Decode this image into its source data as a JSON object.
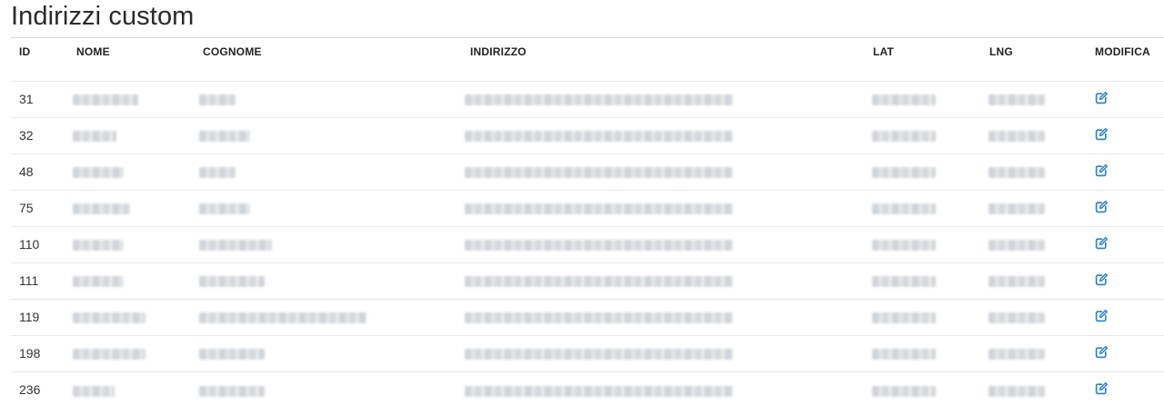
{
  "page": {
    "title": "Indirizzi custom"
  },
  "table": {
    "columns": [
      "ID",
      "NOME",
      "COGNOME",
      "INDIRIZZO",
      "LAT",
      "LNG",
      "MODIFICA"
    ],
    "rows": [
      {
        "id": "31"
      },
      {
        "id": "32"
      },
      {
        "id": "48"
      },
      {
        "id": "75"
      },
      {
        "id": "110"
      },
      {
        "id": "111"
      },
      {
        "id": "119"
      },
      {
        "id": "198"
      },
      {
        "id": "236"
      }
    ],
    "edit_icon": "edit-square-pen-icon",
    "redacted_cells": [
      "NOME",
      "COGNOME",
      "INDIRIZZO",
      "LAT",
      "LNG"
    ]
  },
  "colors": {
    "accent": "#2a7fc9",
    "rule": "#d9d9d9"
  }
}
